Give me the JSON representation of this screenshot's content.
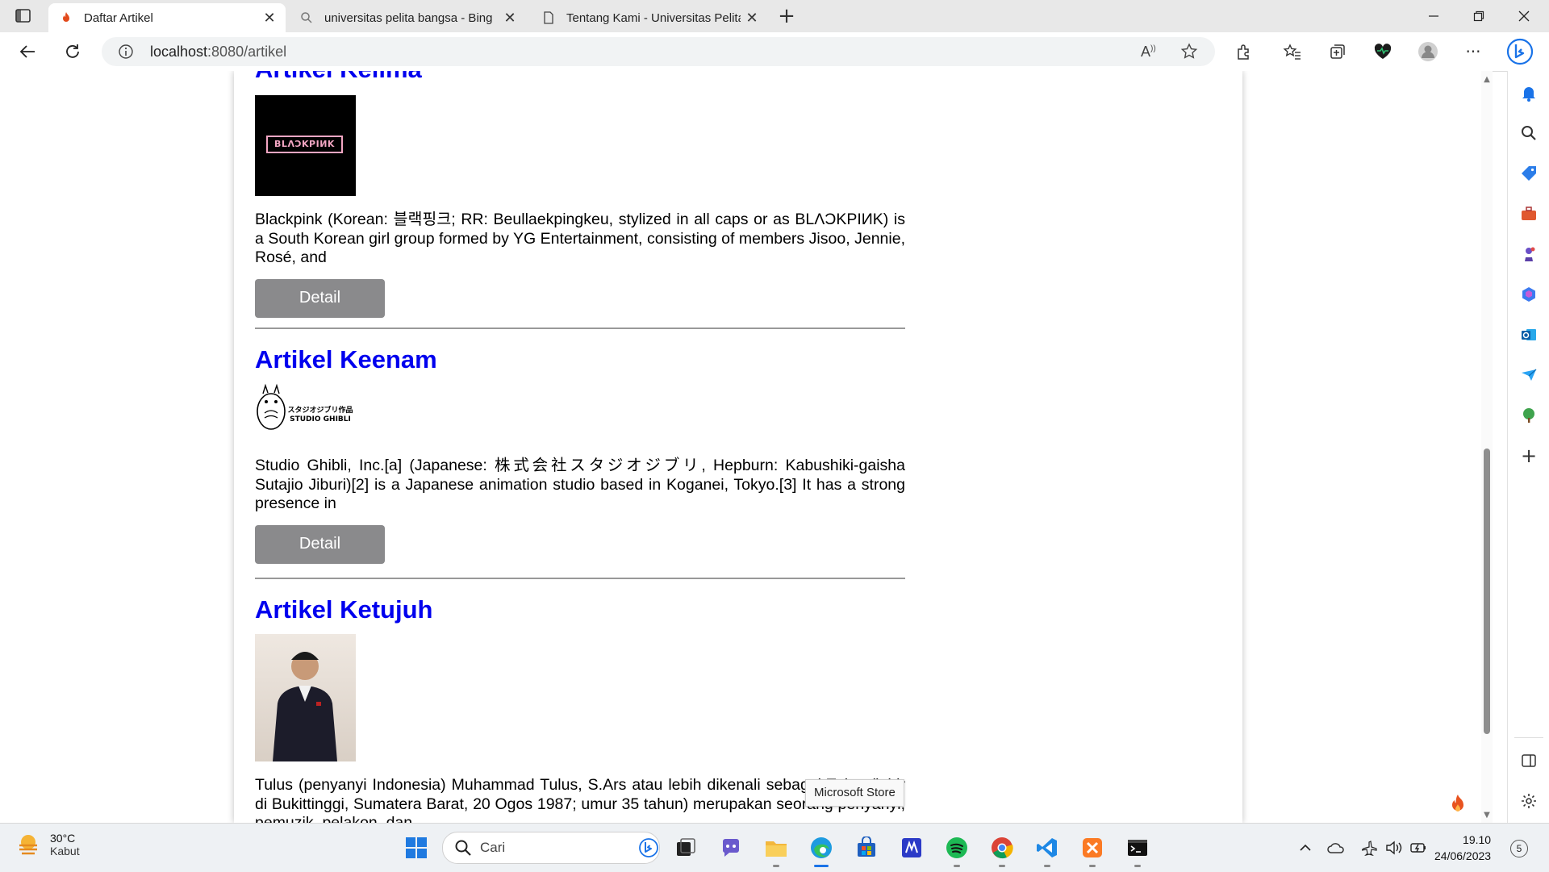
{
  "tabs": [
    {
      "title": "Daftar Artikel",
      "favicon": "fire-icon",
      "active": true
    },
    {
      "title": "universitas pelita bangsa - Bing in",
      "favicon": "search-icon",
      "active": false
    },
    {
      "title": "Tentang Kami - Universitas Pelita",
      "favicon": "page-icon",
      "active": false
    }
  ],
  "address": {
    "host": "localhost",
    "path": ":8080/artikel"
  },
  "articles": [
    {
      "title": "Artikel Kelima",
      "image_text": "BLΛƆKPIИK",
      "description": "Blackpink (Korean: 블랙핑크; RR: Beullaekpingkeu, stylized in all caps or as BLΛƆKPIИK) is a South Korean girl group formed by YG Entertainment, consisting of members Jisoo, Jennie, Rosé, and",
      "button": "Detail"
    },
    {
      "title": "Artikel Keenam",
      "image_text": "スタジオジブリ作品 STUDIO GHIBLI",
      "description": "Studio Ghibli, Inc.[a] (Japanese: 株式会社スタジオジブリ, Hepburn: Kabushiki-gaisha Sutajio Jiburi)[2] is a Japanese animation studio based in Koganei, Tokyo.[3] It has a strong presence in",
      "button": "Detail"
    },
    {
      "title": "Artikel Ketujuh",
      "image_text": "",
      "description": "Tulus (penyanyi Indonesia) Muhammad Tulus, S.Ars atau lebih dikenali sebagai Tulus (lahir di Bukittinggi, Sumatera Barat, 20 Ogos 1987; umur 35 tahun) merupakan seorang penyanyi, pemuzik, pelakon, dan",
      "button": ""
    }
  ],
  "tooltip": "Microsoft Store",
  "taskbar": {
    "weather_temp": "30°C",
    "weather_cond": "Kabut",
    "search_placeholder": "Cari",
    "time": "19.10",
    "date": "24/06/2023",
    "notifications": "5"
  },
  "colors": {
    "link": "#0000ee",
    "button": "#8a8a8c",
    "accent": "#0078d4"
  }
}
